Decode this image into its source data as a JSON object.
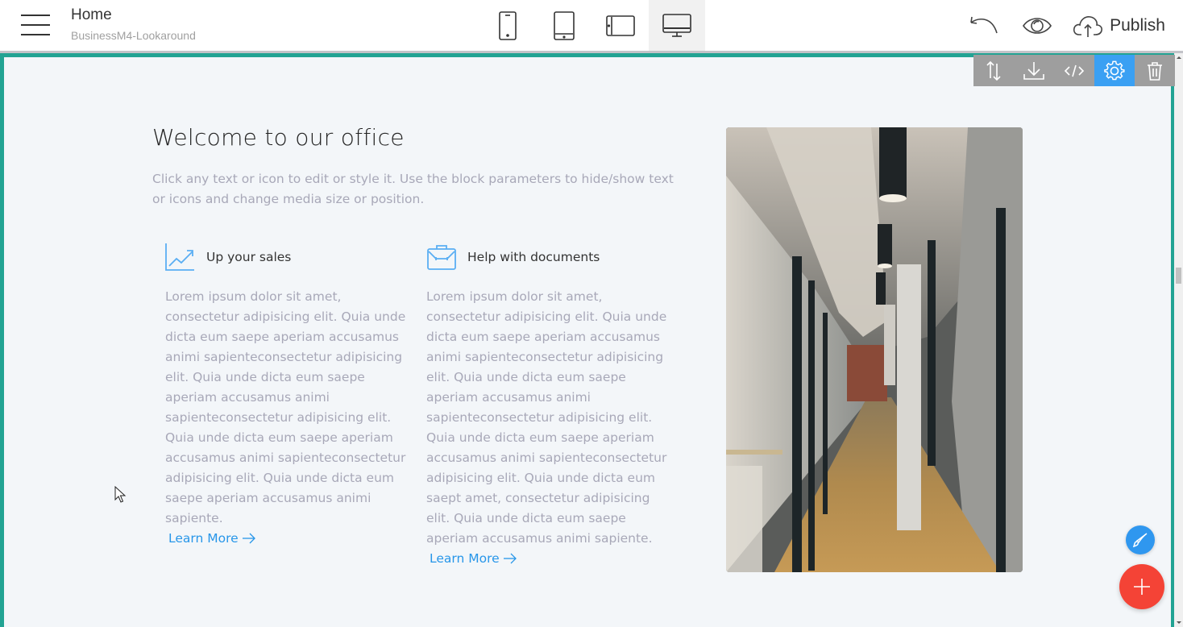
{
  "header": {
    "page_title": "Home",
    "project_name": "BusinessM4-Lookaround",
    "menu_icon": "hamburger-menu-icon",
    "device_modes": [
      {
        "name": "phone",
        "icon": "phone-icon",
        "active": false
      },
      {
        "name": "tablet",
        "icon": "tablet-icon",
        "active": false
      },
      {
        "name": "tablet-landscape",
        "icon": "tablet-landscape-icon",
        "active": false
      },
      {
        "name": "desktop",
        "icon": "desktop-icon",
        "active": true
      }
    ],
    "undo_icon": "undo-icon",
    "preview_icon": "eye-icon",
    "publish_label": "Publish",
    "publish_icon": "cloud-upload-icon"
  },
  "block_toolbar": {
    "items": [
      {
        "name": "reorder",
        "icon": "sort-arrows-icon",
        "active": false
      },
      {
        "name": "save-block",
        "icon": "download-icon",
        "active": false
      },
      {
        "name": "code",
        "icon": "code-icon",
        "active": false
      },
      {
        "name": "block-parameters",
        "icon": "gear-icon",
        "active": true
      },
      {
        "name": "delete",
        "icon": "trash-icon",
        "active": false
      }
    ]
  },
  "content": {
    "headline": "Welcome to our office",
    "intro": "Click any text or icon to edit or style it. Use the block parameters to hide/show text or icons and change media size or position.",
    "features": [
      {
        "icon": "line-chart-icon",
        "title": "Up your sales",
        "text": "Lorem ipsum dolor sit amet, consectetur adipisicing elit. Quia unde dicta eum saepe aperiam accusamus animi sapienteconsectetur adipisicing elit. Quia unde dicta eum saepe aperiam accusamus animi sapienteconsectetur adipisicing elit. Quia unde dicta eum saepe aperiam accusamus animi sapienteconsectetur adipisicing elit. Quia unde dicta eum saepe aperiam accusamus animi sapiente.",
        "link": "Learn More"
      },
      {
        "icon": "briefcase-icon",
        "title": "Help with documents",
        "text": "Lorem ipsum dolor sit amet, consectetur adipisicing elit. Quia unde dicta eum saepe aperiam accusamus animi sapienteconsectetur adipisicing elit. Quia unde dicta eum saepe aperiam accusamus animi sapienteconsectetur adipisicing elit. Quia unde dicta eum saepe aperiam accusamus animi sapienteconsectetur adipisicing elit. Quia unde dicta eum saept amet, consectetur adipisicing elit. Quia unde dicta eum saepe aperiam accusamus animi sapiente.",
        "link": "Learn More"
      }
    ],
    "image_alt": "Office corridor with glass walls, concrete pillars and polished floor"
  },
  "floating": {
    "brush_icon": "paint-brush-icon",
    "add_icon": "plus-icon"
  },
  "colors": {
    "accent_teal": "#22a393",
    "accent_blue": "#2796e9",
    "toolbar_active": "#3aa0f3",
    "fab_red": "#f44336"
  }
}
